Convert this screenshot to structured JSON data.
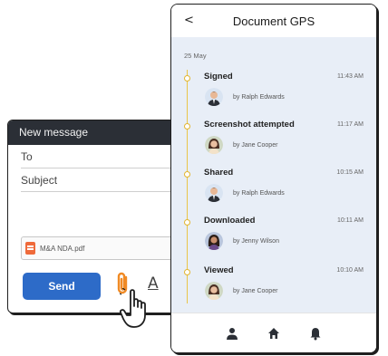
{
  "compose": {
    "header": "New message",
    "to_label": "To",
    "subject_label": "Subject",
    "attachment": {
      "icon": "pdf-file-icon",
      "name": "M&A NDA.pdf"
    },
    "send_label": "Send",
    "format_icon_text": "A"
  },
  "gps": {
    "back_icon_text": "<",
    "title": "Document GPS",
    "date": "25 May",
    "events": [
      {
        "title": "Signed",
        "time": "11:43 AM",
        "user": "by Ralph Edwards"
      },
      {
        "title": "Screenshot attempted",
        "time": "11:17 AM",
        "user": "by Jane Cooper"
      },
      {
        "title": "Shared",
        "time": "10:15 AM",
        "user": "by Ralph Edwards"
      },
      {
        "title": "Downloaded",
        "time": "10:11 AM",
        "user": "by Jenny Wilson"
      },
      {
        "title": "Viewed",
        "time": "10:10 AM",
        "user": "by Jane Cooper"
      }
    ]
  },
  "colors": {
    "send": "#2d6bc8",
    "timeline": "#e3b52d",
    "feed_bg": "#e8eef7",
    "compose_header": "#2b2f36",
    "clip": "#f08a24"
  }
}
